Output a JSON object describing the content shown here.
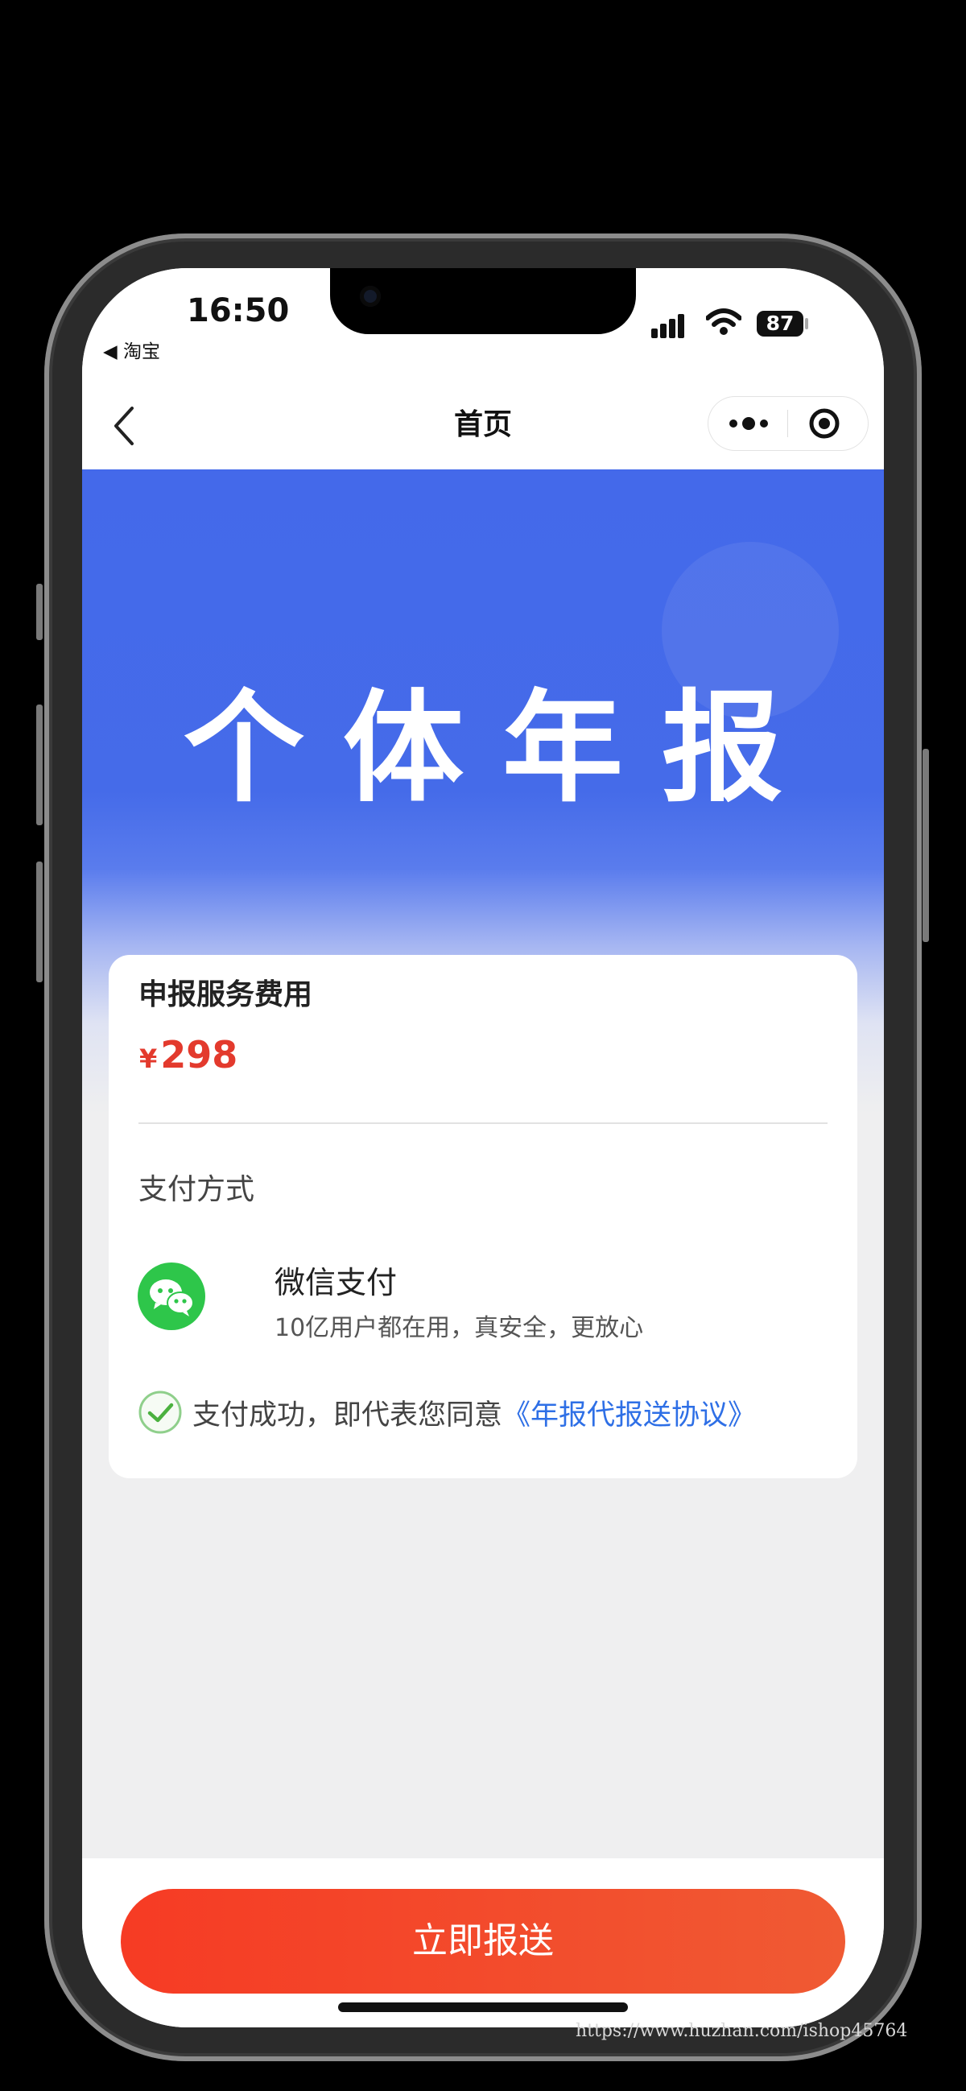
{
  "status_bar": {
    "time": "16:50",
    "back_app": "◀ 淘宝",
    "battery": "87"
  },
  "navbar": {
    "title": "首页",
    "back_icon": "chevron-left-icon",
    "more_icon": "more-dots-icon",
    "close_icon": "target-circle-icon"
  },
  "banner": {
    "title": "个体年报",
    "color": "#4469ea"
  },
  "fee": {
    "label": "申报服务费用",
    "currency": "¥",
    "amount": "298",
    "color": "#e33a2d"
  },
  "payment": {
    "label": "支付方式",
    "method_name": "微信支付",
    "method_desc": "10亿用户都在用，真安全，更放心",
    "method_icon": "wechat-icon",
    "checked": true
  },
  "agreement": {
    "text": "支付成功，即代表您同意",
    "link": "《年报代报送协议》",
    "link_color": "#2e6fe6"
  },
  "submit": {
    "label": "立即报送",
    "color": "#f63b24"
  },
  "watermark": "https://www.huzhan.com/ishop45764"
}
